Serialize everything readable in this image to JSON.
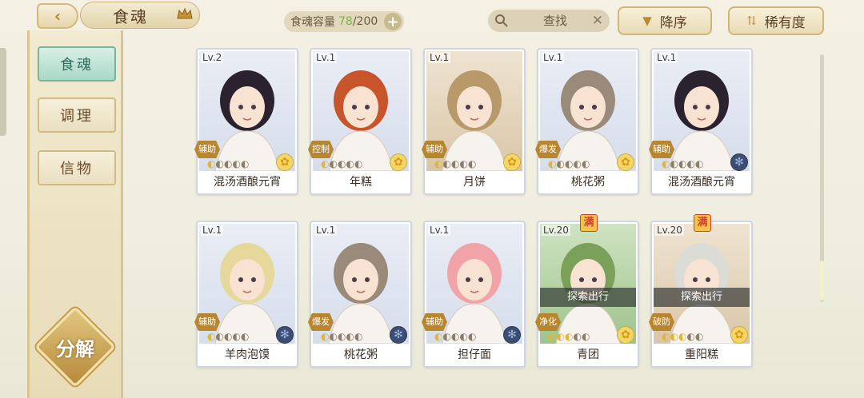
{
  "header": {
    "title": "食魂",
    "capacity_label": "食魂容量",
    "capacity_current": "78",
    "capacity_total": "/200",
    "search_placeholder": "查找",
    "sort_order_label": "降序",
    "sort_by_label": "稀有度"
  },
  "sidebar": {
    "tabs": [
      {
        "label": "食魂"
      },
      {
        "label": "调理"
      },
      {
        "label": "信物"
      }
    ],
    "decompose_label": "分解"
  },
  "cards": [
    {
      "level": "Lv.2",
      "role": "辅助",
      "name": "混汤酒酿元宵",
      "element": "gold",
      "stars": 1,
      "full": "",
      "explore": "",
      "bg": "blue"
    },
    {
      "level": "Lv.1",
      "role": "控制",
      "name": "年糕",
      "element": "gold",
      "stars": 1,
      "full": "",
      "explore": "",
      "bg": "blue"
    },
    {
      "level": "Lv.1",
      "role": "辅助",
      "name": "月饼",
      "element": "gold",
      "stars": 1,
      "full": "",
      "explore": "",
      "bg": "warm"
    },
    {
      "level": "Lv.1",
      "role": "爆发",
      "name": "桃花粥",
      "element": "gold",
      "stars": 1,
      "full": "",
      "explore": "",
      "bg": "blue"
    },
    {
      "level": "Lv.1",
      "role": "辅助",
      "name": "混汤酒酿元宵",
      "element": "blue",
      "stars": 1,
      "full": "",
      "explore": "",
      "bg": "blue"
    },
    {
      "level": "Lv.1",
      "role": "辅助",
      "name": "羊肉泡馍",
      "element": "blue",
      "stars": 1,
      "full": "",
      "explore": "",
      "bg": "blue"
    },
    {
      "level": "Lv.1",
      "role": "爆发",
      "name": "桃花粥",
      "element": "blue",
      "stars": 1,
      "full": "",
      "explore": "",
      "bg": "blue"
    },
    {
      "level": "Lv.1",
      "role": "辅助",
      "name": "担仔面",
      "element": "blue",
      "stars": 1,
      "full": "",
      "explore": "",
      "bg": "blue"
    },
    {
      "level": "Lv.20",
      "role": "净化",
      "name": "青团",
      "element": "gold",
      "stars": 3,
      "full": "满",
      "explore": "探索出行",
      "bg": "green"
    },
    {
      "level": "Lv.20",
      "role": "破防",
      "name": "重阳糕",
      "element": "gold",
      "stars": 3,
      "full": "满",
      "explore": "探索出行",
      "bg": "warm"
    }
  ]
}
